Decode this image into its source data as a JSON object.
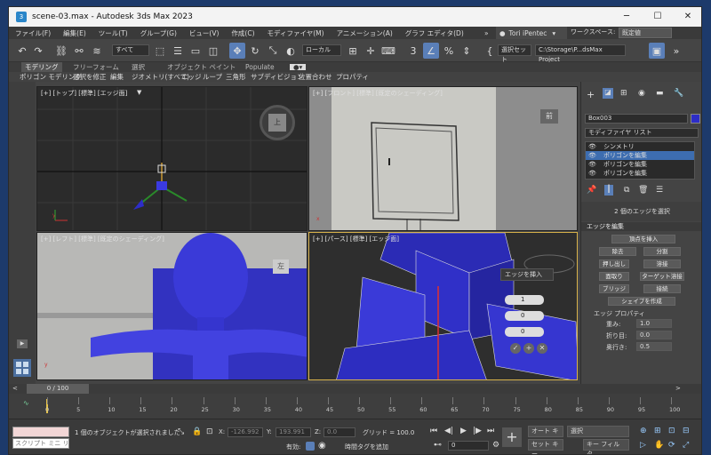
{
  "window": {
    "title": "scene-03.max - Autodesk 3ds Max 2023",
    "app_icon": "3"
  },
  "window_controls": {
    "minimize": "─",
    "maximize": "☐",
    "close": "✕"
  },
  "menu": [
    "ファイル(F)",
    "編集(E)",
    "ツール(T)",
    "グループ(G)",
    "ビュー(V)",
    "作成(C)",
    "モディファイヤ(M)",
    "アニメーション(A)",
    "グラフ エディタ(D)"
  ],
  "menu_more": "»",
  "user": {
    "name": "Tori iPentec",
    "icon": "user-icon"
  },
  "workspace": {
    "label": "ワークスペース:",
    "value": "既定値"
  },
  "toolbar": {
    "filter_value": "すべて",
    "refcoord_value": "ローカル",
    "selset_label": "選択セット",
    "project_path": "C:\\Storage\\P...dsMax Project"
  },
  "ribbon_tabs": [
    "モデリング",
    "フリーフォーム",
    "選択",
    "オブジェクト ペイント",
    "Populate"
  ],
  "ribbon_sub": [
    "ポリゴン モデリング",
    "選択を修正",
    "編集",
    "ジオメトリ(すべて)",
    "エッジ",
    "ループ",
    "三角形",
    "サブディビジョン",
    "位置合わせ",
    "プロパティ"
  ],
  "viewports": {
    "top": {
      "label": "[+] [トップ] [標準] [エッジ面]",
      "viewcube": "上",
      "filter": "▼"
    },
    "front": {
      "label": "[+] [フロント] [標準] [既定のシェーディング]",
      "viewcube": "前"
    },
    "left": {
      "label": "[+] [レフト] [標準] [既定のシェーディング]",
      "viewcube": "左"
    },
    "persp": {
      "label": "[+] [パース] [標準] [エッジ面]",
      "caddy_title": "エッジを挿入",
      "caddy_values": [
        "1",
        "0",
        "0"
      ]
    }
  },
  "command_panel": {
    "object_name": "Box003",
    "modifier_list": "モディファイヤ リスト",
    "stack": [
      "シンメトリ",
      "ポリゴンを編集",
      "ポリゴンを編集",
      "ポリゴンを編集"
    ],
    "sel_info": "2 個のエッジを選択",
    "rollout_edit_edges": "エッジを編集",
    "btn_insert_vertex": "頂点を挿入",
    "btn_remove": "除去",
    "btn_split": "分割",
    "btn_extrude": "押し出し",
    "btn_weld": "溶接",
    "btn_chamfer": "面取り",
    "btn_target_weld": "ターゲット溶接",
    "btn_bridge": "ブリッジ",
    "btn_connect": "接続",
    "btn_create_shape": "シェイプを作成",
    "edge_props_title": "エッジ プロパティ",
    "weight_label": "重み:",
    "weight_value": "1.0",
    "crease_label": "折り目:",
    "crease_value": "0.0",
    "depth_label": "奥行き:",
    "depth_value": "0.5"
  },
  "time": {
    "slider_label": "0 / 100",
    "ticks": [
      "0",
      "5",
      "10",
      "15",
      "20",
      "25",
      "30",
      "35",
      "40",
      "45",
      "50",
      "55",
      "60",
      "65",
      "70",
      "75",
      "80",
      "85",
      "90",
      "95",
      "100"
    ]
  },
  "status": {
    "mini_listener": "スクリプト ミニ リス",
    "selection_msg": "1 個のオブジェクトが選択されました",
    "x_label": "X:",
    "x_value": "-126.992",
    "y_label": "Y:",
    "y_value": "193.991",
    "z_label": "Z:",
    "z_value": "0.0",
    "grid": "グリッド = 100.0",
    "enabled_label": "有効:",
    "add_time_tag": "時間タグを追加",
    "auto_key": "オート キー",
    "set_key": "セット キー",
    "key_mode": "選択",
    "key_filter": "キー フィルタ...",
    "frame_value": "0"
  },
  "colors": {
    "accent": "#5a7fb8",
    "object_blue": "#2d2dc8",
    "desktop": "#1d3a6b"
  }
}
